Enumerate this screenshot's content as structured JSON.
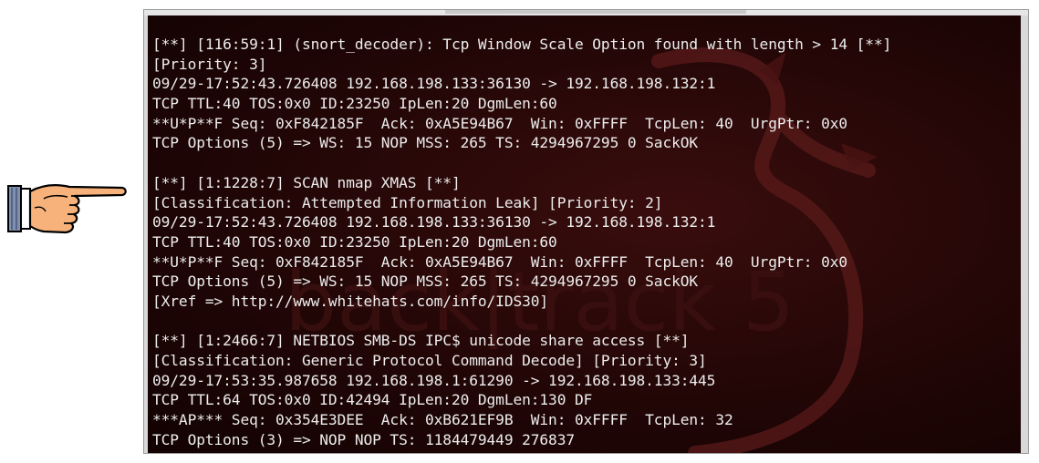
{
  "pointer": {
    "icon": "pointing-hand-icon"
  },
  "terminal": {
    "watermark": "back|track 5",
    "alerts": [
      {
        "lines": [
          "[**] [116:59:1] (snort_decoder): Tcp Window Scale Option found with length > 14 [**]",
          "[Priority: 3]",
          "09/29-17:52:43.726408 192.168.198.133:36130 -> 192.168.198.132:1",
          "TCP TTL:40 TOS:0x0 ID:23250 IpLen:20 DgmLen:60",
          "**U*P**F Seq: 0xF842185F  Ack: 0xA5E94B67  Win: 0xFFFF  TcpLen: 40  UrgPtr: 0x0",
          "TCP Options (5) => WS: 15 NOP MSS: 265 TS: 4294967295 0 SackOK"
        ]
      },
      {
        "lines": [
          "[**] [1:1228:7] SCAN nmap XMAS [**]",
          "[Classification: Attempted Information Leak] [Priority: 2]",
          "09/29-17:52:43.726408 192.168.198.133:36130 -> 192.168.198.132:1",
          "TCP TTL:40 TOS:0x0 ID:23250 IpLen:20 DgmLen:60",
          "**U*P**F Seq: 0xF842185F  Ack: 0xA5E94B67  Win: 0xFFFF  TcpLen: 40  UrgPtr: 0x0",
          "TCP Options (5) => WS: 15 NOP MSS: 265 TS: 4294967295 0 SackOK",
          "[Xref => http://www.whitehats.com/info/IDS30]"
        ]
      },
      {
        "lines": [
          "[**] [1:2466:7] NETBIOS SMB-DS IPC$ unicode share access [**]",
          "[Classification: Generic Protocol Command Decode] [Priority: 3]",
          "09/29-17:53:35.987658 192.168.198.1:61290 -> 192.168.198.133:445",
          "TCP TTL:64 TOS:0x0 ID:42494 IpLen:20 DgmLen:130 DF",
          "***AP*** Seq: 0x354E3DEE  Ack: 0xB621EF9B  Win: 0xFFFF  TcpLen: 32",
          "TCP Options (3) => NOP NOP TS: 1184479449 276837"
        ]
      }
    ]
  }
}
